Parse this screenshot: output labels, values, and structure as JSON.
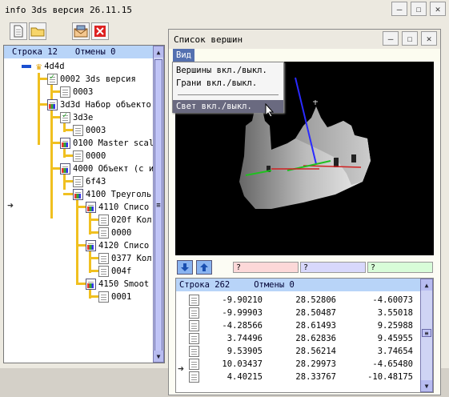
{
  "main_window": {
    "title": "info 3ds версия 26.11.15",
    "min": "—",
    "max": "☐",
    "close": "✕"
  },
  "tree_header": {
    "row": "Строка 12",
    "undo": "Отмены 0"
  },
  "tree": [
    {
      "label": "4d4d"
    },
    {
      "label": "0002 3ds версия"
    },
    {
      "label": "0003"
    },
    {
      "label": "3d3d Набор объекто"
    },
    {
      "label": "3d3e"
    },
    {
      "label": "0003"
    },
    {
      "label": "0100 Master scal"
    },
    {
      "label": "0000"
    },
    {
      "label": "4000 Объект (с и"
    },
    {
      "label": "6f43"
    },
    {
      "label": "4100 Треуголь"
    },
    {
      "label": "4110 Списо"
    },
    {
      "label": "020f Кол"
    },
    {
      "label": "0000"
    },
    {
      "label": "4120 Списо"
    },
    {
      "label": "0377 Кол"
    },
    {
      "label": "004f"
    },
    {
      "label": "4150 Smoot"
    },
    {
      "label": "0001"
    }
  ],
  "vert_window": {
    "title": "Список вершин",
    "min": "—",
    "max": "☐",
    "close": "✕"
  },
  "menu": {
    "bar": "Вид",
    "items": [
      "Вершины вкл./выкл.",
      "Грани вкл./выкл.",
      "Свет вкл./выкл."
    ]
  },
  "fields": [
    "?",
    "?",
    "?"
  ],
  "list_header": {
    "row": "Строка 262",
    "undo": "Отмены 0"
  },
  "table": [
    [
      "-9.90210",
      "28.52806",
      "-4.60073"
    ],
    [
      "-9.99903",
      "28.50487",
      "3.55018"
    ],
    [
      "-4.28566",
      "28.61493",
      "9.25988"
    ],
    [
      "3.74496",
      "28.62836",
      "9.45955"
    ],
    [
      "9.53905",
      "28.56214",
      "3.74654"
    ],
    [
      "10.03437",
      "28.29973",
      "-4.65480"
    ],
    [
      "4.40215",
      "28.33767",
      "-10.48175"
    ]
  ],
  "colors": {
    "header": "#b8d4f8",
    "tree_line": "#f0c020",
    "field_red": "#fcd8d8",
    "field_blue": "#d8d8fc",
    "field_green": "#d8fcd8"
  }
}
